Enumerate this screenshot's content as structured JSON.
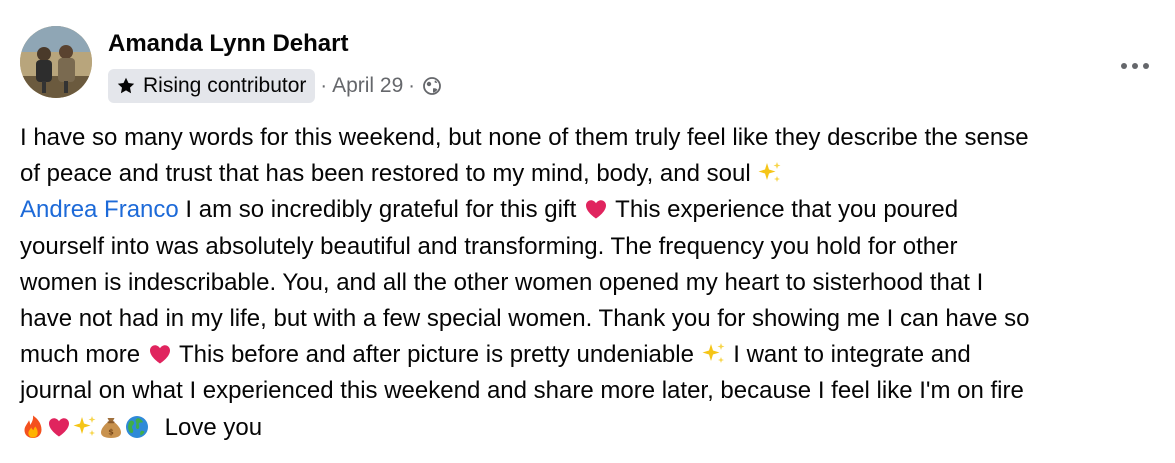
{
  "post": {
    "author": "Amanda Lynn Dehart",
    "badge": "Rising contributor",
    "meta_separator": "·",
    "date": "April 29",
    "audience_icon": "globe-icon",
    "more_icon": "more-options-icon",
    "avatar_icon": "profile-photo"
  },
  "body": {
    "line1": "I have so many words for this weekend, but none of them truly feel like they describe the sense",
    "line2": "of peace and trust that has been restored to my mind, body, and soul",
    "mention": "Andrea Franco",
    "line3_rest": " I am so incredibly grateful for this gift",
    "line3_tail": " This experience that you poured",
    "line4": "yourself into was absolutely beautiful and transforming. The frequency you hold for other",
    "line5": "women is indescribable. You, and all the other women opened my heart to sisterhood that I",
    "line6": "have not had in my life, but with a few special women. Thank you for showing me I can have so",
    "line7_a": "much more",
    "line7_b": " This before and after picture is pretty undeniable",
    "line7_c": " I want to integrate and",
    "line8": "journal on what I experienced this weekend and share more later, because I feel like I'm on fire",
    "line9_text": "Love you",
    "emojis": [
      "sparkles",
      "red-heart",
      "fire",
      "red-heart",
      "sparkles",
      "money-bag",
      "globe-earth"
    ]
  },
  "colors": {
    "mention": "#1d6ad8",
    "secondary_text": "#65676b",
    "badge_bg": "#e4e6eb",
    "heart": "#e0245e",
    "sparkle": "#f5c518"
  }
}
